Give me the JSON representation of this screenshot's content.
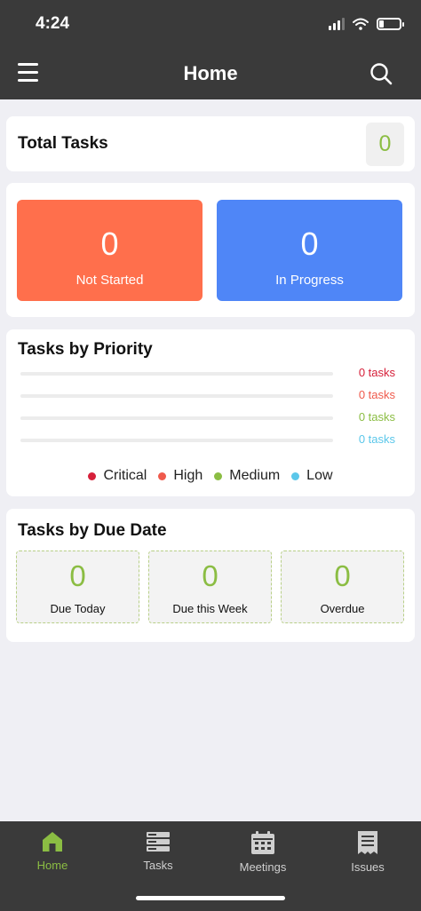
{
  "status_bar": {
    "time": "4:24"
  },
  "header": {
    "title": "Home"
  },
  "total_tasks": {
    "label": "Total Tasks",
    "count": "0"
  },
  "status_tiles": [
    {
      "label": "Not Started",
      "count": "0",
      "color": "#ff6f4c"
    },
    {
      "label": "In Progress",
      "count": "0",
      "color": "#4f86f7"
    }
  ],
  "priority": {
    "title": "Tasks by Priority",
    "rows": [
      {
        "level": "Critical",
        "value": "0 tasks",
        "fraction": 0,
        "color": "#d6203a"
      },
      {
        "level": "High",
        "value": "0 tasks",
        "fraction": 0,
        "color": "#ef5a4c"
      },
      {
        "level": "Medium",
        "value": "0 tasks",
        "fraction": 0,
        "color": "#8bbd43"
      },
      {
        "level": "Low",
        "value": "0 tasks",
        "fraction": 0,
        "color": "#5bc7ea"
      }
    ],
    "legend": [
      "Critical",
      "High",
      "Medium",
      "Low"
    ]
  },
  "due_date": {
    "title": "Tasks by Due Date",
    "tiles": [
      {
        "label": "Due Today",
        "count": "0"
      },
      {
        "label": "Due this Week",
        "count": "0"
      },
      {
        "label": "Overdue",
        "count": "0"
      }
    ]
  },
  "bottom_nav": {
    "items": [
      {
        "label": "Home",
        "icon": "home-icon",
        "active": true
      },
      {
        "label": "Tasks",
        "icon": "tasks-icon",
        "active": false
      },
      {
        "label": "Meetings",
        "icon": "calendar-icon",
        "active": false
      },
      {
        "label": "Issues",
        "icon": "issues-icon",
        "active": false
      }
    ]
  },
  "colors": {
    "accent": "#8bbd43",
    "header_bg": "#3a3a3a"
  }
}
